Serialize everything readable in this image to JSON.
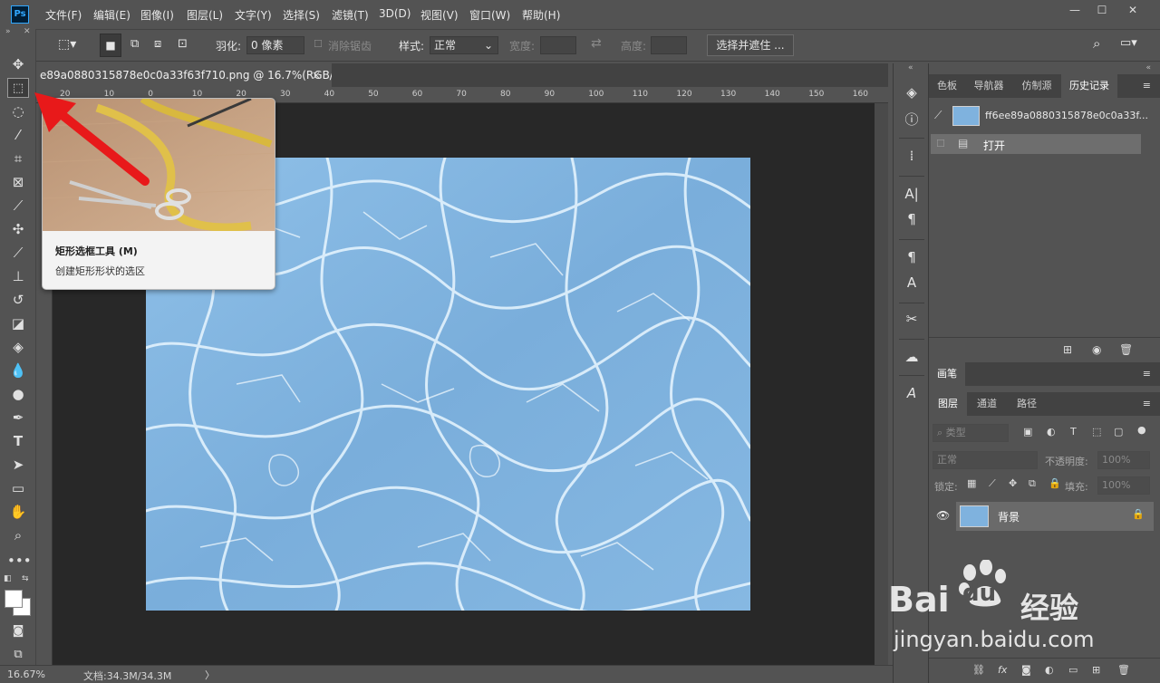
{
  "app": {
    "logo_text": "Ps"
  },
  "menu": [
    "文件(F)",
    "编辑(E)",
    "图像(I)",
    "图层(L)",
    "文字(Y)",
    "选择(S)",
    "滤镜(T)",
    "3D(D)",
    "视图(V)",
    "窗口(W)",
    "帮助(H)"
  ],
  "options": {
    "feather_label": "羽化:",
    "feather_value": "0 像素",
    "antialias_label": "消除锯齿",
    "style_label": "样式:",
    "style_value": "正常",
    "width_label": "宽度:",
    "height_label": "高度:",
    "select_mask_button": "选择并遮住 ..."
  },
  "document": {
    "tab_title": "e89a0880315878e0c0a33f63f710.png @ 16.7%(RGB/8)",
    "close": "×"
  },
  "ruler_h": [
    "20",
    "10",
    "0",
    "10",
    "20",
    "30",
    "40",
    "50",
    "60",
    "70",
    "80",
    "90",
    "100",
    "110",
    "120",
    "130",
    "140",
    "150",
    "160"
  ],
  "tooltip": {
    "title": "矩形选框工具 (M)",
    "description": "创建矩形形状的选区"
  },
  "status": {
    "zoom": "16.67%",
    "doc_size": "文档:34.3M/34.3M",
    "arrow": "〉"
  },
  "panels": {
    "top_tabs": [
      "色板",
      "导航器",
      "仿制源",
      "历史记录"
    ],
    "history": {
      "snapshot_name": "ff6ee89a0880315878e0c0a33f...",
      "step": "打开"
    },
    "brush_tab": "画笔",
    "layer_tabs": [
      "图层",
      "通道",
      "路径"
    ],
    "layers": {
      "filter_placeholder": "类型",
      "blend_mode": "正常",
      "opacity_label": "不透明度:",
      "opacity_value": "100%",
      "lock_label": "锁定:",
      "fill_label": "填充:",
      "fill_value": "100%",
      "layer_name": "背景"
    }
  },
  "watermark": {
    "logo": "Bai",
    "logo_tail": "du",
    "brand": "经验",
    "url": "jingyan.baidu.com"
  }
}
